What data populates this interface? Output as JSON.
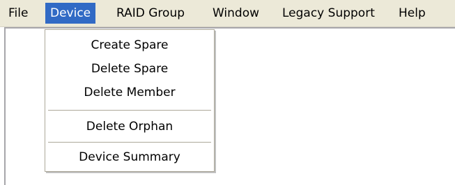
{
  "menubar": {
    "items": [
      {
        "label": "File"
      },
      {
        "label": "Device"
      },
      {
        "label": "RAID Group"
      },
      {
        "label": "Window"
      },
      {
        "label": "Legacy Support"
      },
      {
        "label": "Help"
      }
    ]
  },
  "device_menu": {
    "items": [
      {
        "label": "Create Spare"
      },
      {
        "label": "Delete Spare"
      },
      {
        "label": "Delete Member"
      },
      {
        "label": "Delete Orphan"
      },
      {
        "label": "Device Summary"
      }
    ]
  },
  "colors": {
    "menubar_bg": "#ece9d8",
    "highlight": "#316ac5",
    "highlight_text": "#ffffff",
    "menu_bg": "#ffffff",
    "menu_border": "#aca899"
  }
}
